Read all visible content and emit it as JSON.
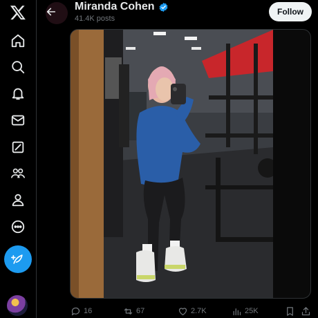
{
  "header": {
    "display_name": "Miranda Cohen",
    "post_count": "41.4K posts",
    "follow_label": "Follow"
  },
  "sidebar": {
    "items": [
      {
        "icon": "x-logo-icon"
      },
      {
        "icon": "home-icon"
      },
      {
        "icon": "search-icon"
      },
      {
        "icon": "notifications-icon"
      },
      {
        "icon": "messages-icon"
      },
      {
        "icon": "grok-icon"
      },
      {
        "icon": "communities-icon"
      },
      {
        "icon": "profile-icon"
      },
      {
        "icon": "more-icon"
      },
      {
        "icon": "compose-post-icon"
      }
    ]
  },
  "post": {
    "replies": "16",
    "reposts": "67",
    "likes": "2.7K",
    "views": "25K"
  },
  "colors": {
    "accent": "#1d9bf0",
    "background": "#000000",
    "text": "#e7e9ea",
    "muted": "#71767b",
    "repost_green": "#00ba7c"
  }
}
